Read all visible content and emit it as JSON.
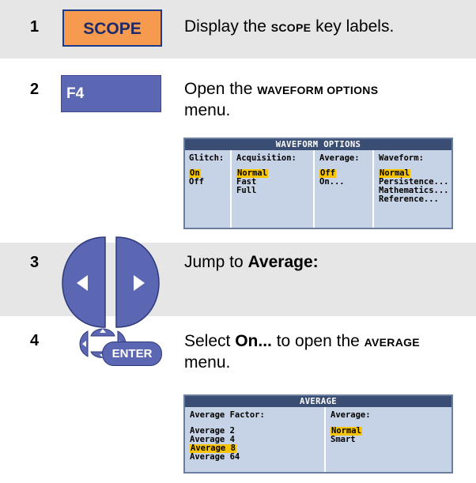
{
  "steps": [
    {
      "number": "1",
      "key_label": "SCOPE",
      "desc_pre": "Display the ",
      "desc_sc": "SCOPE",
      "desc_post": " key labels."
    },
    {
      "number": "2",
      "key_label": "F4",
      "desc_pre": "Open the ",
      "desc_sc": "WAVEFORM OPTIONS",
      "desc_post": "menu."
    },
    {
      "number": "3",
      "desc_pre": "Jump to ",
      "desc_bold": "Average:"
    },
    {
      "number": "4",
      "enter_label": "ENTER",
      "desc_pre": "Select ",
      "desc_bold": "On...",
      "desc_mid": " to open the ",
      "desc_sc": "AVERAGE",
      "desc_post": "menu."
    }
  ],
  "waveform_menu": {
    "title": "WAVEFORM OPTIONS",
    "columns": [
      {
        "header": "Glitch:",
        "items": [
          "On",
          "Off"
        ],
        "selected": "On"
      },
      {
        "header": "Acquisition:",
        "items": [
          "Normal",
          "Fast",
          "Full"
        ],
        "selected": "Normal"
      },
      {
        "header": "Average:",
        "items": [
          "Off",
          "On..."
        ],
        "selected": "Off"
      },
      {
        "header": "Waveform:",
        "items": [
          "Normal",
          "Persistence...",
          "Mathematics...",
          "Reference..."
        ],
        "selected": "Normal"
      }
    ]
  },
  "average_menu": {
    "title": "AVERAGE",
    "columns": [
      {
        "header": "Average Factor:",
        "items": [
          "Average 2",
          "Average 4",
          "Average 8",
          "Average 64"
        ],
        "selected": "Average 8"
      },
      {
        "header": "Average:",
        "items": [
          "Normal",
          "Smart"
        ],
        "selected": "Normal"
      }
    ]
  },
  "colors": {
    "band_gray": "#e6e6e6",
    "scope_key": "#f59a4f",
    "function_key": "#5c67b3",
    "arrow_button": "#5c67b3",
    "menu_bg": "#c6d2e6",
    "menu_title": "#3a4d73",
    "highlight": "#f8c400"
  },
  "icons": [
    "left-arrow-button-icon",
    "right-arrow-button-icon",
    "navigation-pad-icon",
    "enter-button-icon"
  ]
}
